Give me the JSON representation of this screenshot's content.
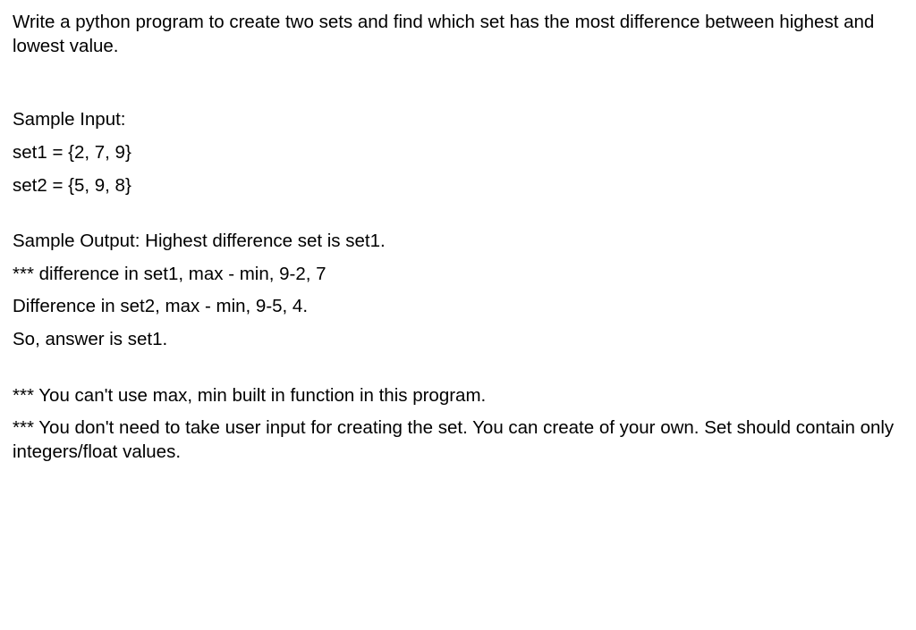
{
  "lines": {
    "intro": "Write a python program to create two sets and find which set has the most difference between highest and lowest value.",
    "sample_input_label": "Sample Input:",
    "set1": "set1 = {2, 7, 9}",
    "set2": "set2 = {5, 9, 8}",
    "sample_output": "Sample Output: Highest difference set is set1.",
    "diff1": "*** difference in set1, max - min, 9-2, 7",
    "diff2": "Difference in set2, max - min, 9-5, 4.",
    "so_answer": "So, answer is set1.",
    "note1": "*** You can't use max, min built in function in this program.",
    "note2": "*** You don't need to take user input for creating the set. You can create of your own. Set should contain only integers/float values."
  }
}
